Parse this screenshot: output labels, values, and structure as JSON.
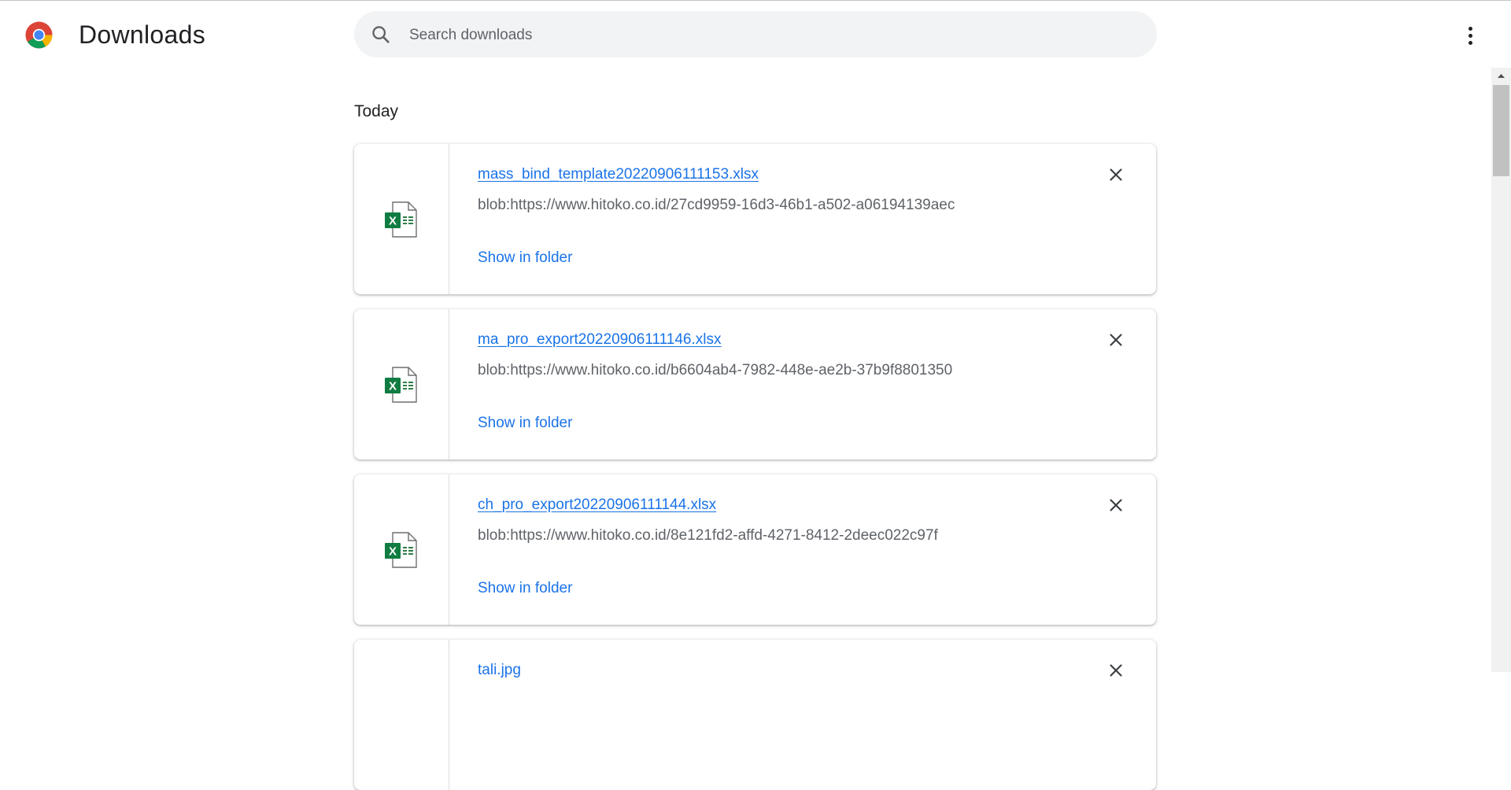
{
  "header": {
    "title": "Downloads",
    "logo_icon": "chrome-logo-icon",
    "search_placeholder": "Search downloads",
    "menu_icon": "more-vert-icon"
  },
  "sections": [
    {
      "title": "Today",
      "items": [
        {
          "file_name": "mass_bind_template20220906111153.xlsx",
          "url": "blob:https://www.hitoko.co.id/27cd9959-16d3-46b1-a502-a06194139aec",
          "action": "Show in folder",
          "icon": "excel-file-icon"
        },
        {
          "file_name": "ma_pro_export20220906111146.xlsx",
          "url": "blob:https://www.hitoko.co.id/b6604ab4-7982-448e-ae2b-37b9f8801350",
          "action": "Show in folder",
          "icon": "excel-file-icon"
        },
        {
          "file_name": "ch_pro_export20220906111144.xlsx",
          "url": "blob:https://www.hitoko.co.id/8e121fd2-affd-4271-8412-2deec022c97f",
          "action": "Show in folder",
          "icon": "excel-file-icon"
        },
        {
          "file_name": "tali.jpg",
          "icon": "image-file-icon"
        }
      ]
    }
  ],
  "colors": {
    "link": "#1a73e8",
    "secondary_text": "#5f6368",
    "search_bg": "#f1f3f4",
    "excel_green": "#107c41"
  }
}
